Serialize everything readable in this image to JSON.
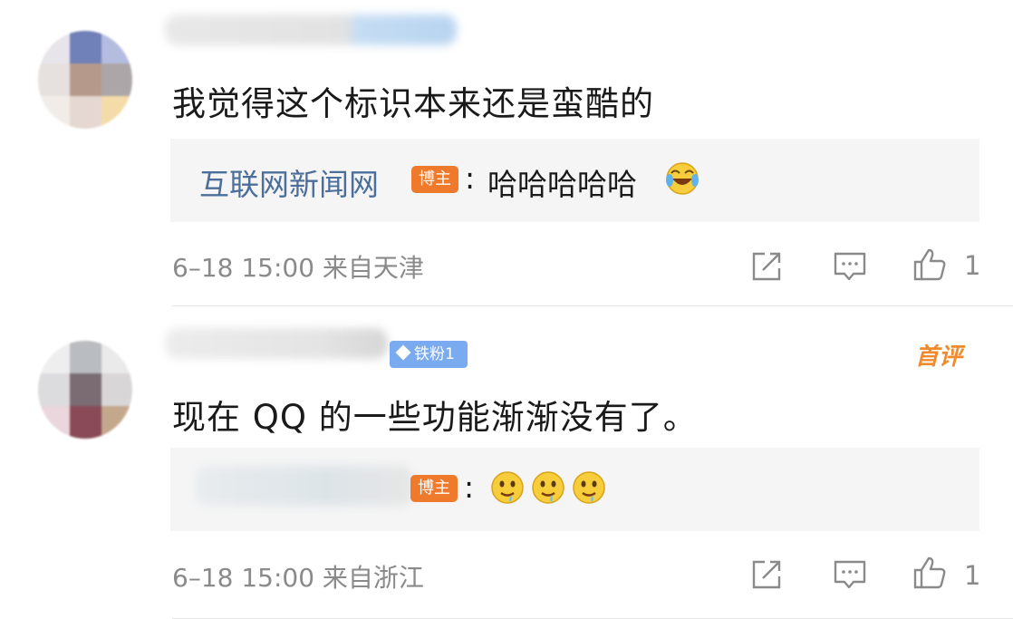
{
  "comments": [
    {
      "text": "我觉得这个标识本来还是蛮酷的",
      "reply": {
        "author": "互联网新闻网",
        "badge": "博主",
        "colon": ":",
        "text": "哈哈哈哈哈",
        "emoji": "laughing-crying-emoji"
      },
      "meta": "6–18 15:00 来自天津",
      "like_count": "1"
    },
    {
      "fan_badge": "铁粉1",
      "first_tag": "首评",
      "text": "现在 QQ 的一些功能渐渐没有了。",
      "reply": {
        "badge": "博主",
        "colon": ":",
        "emoji": "drooling-emoji"
      },
      "meta": "6–18 15:00 来自浙江",
      "like_count": "1"
    }
  ],
  "colors": {
    "link": "#4c6e9b",
    "badge": "#f07a2b",
    "fan_badge": "#7aaaf0",
    "first_tag": "#f08a2e",
    "meta": "#8a8a8a"
  }
}
